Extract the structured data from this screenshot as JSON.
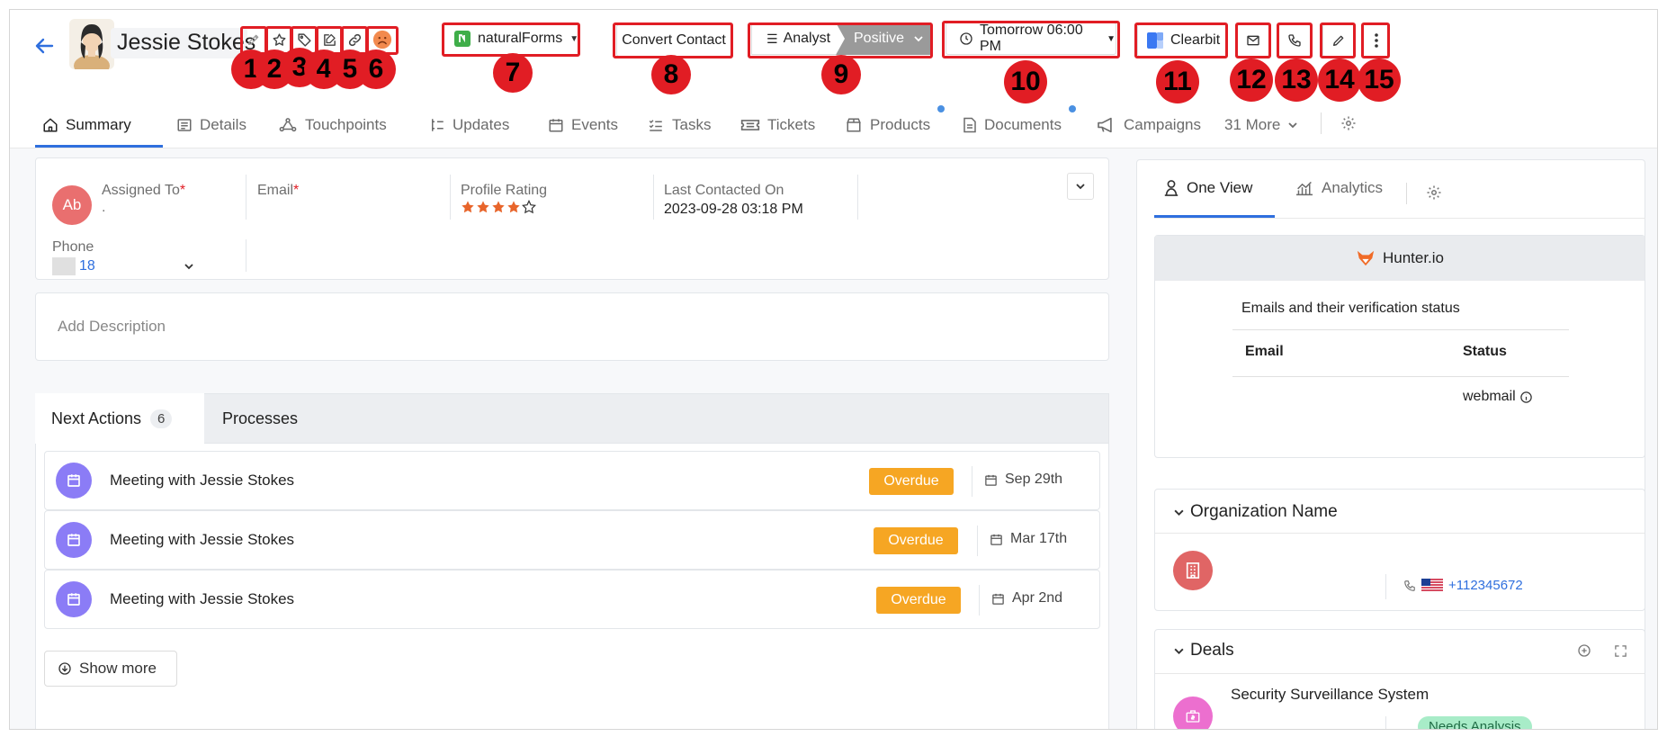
{
  "header": {
    "contact_name": "Jessie Stokes",
    "form_selector": "naturalForms",
    "convert_button": "Convert Contact",
    "pipeline_stage": "Analyst",
    "pipeline_status": "Positive",
    "reminder": "Tomorrow 06:00 PM",
    "integration_button": "Clearbit"
  },
  "annotations": [
    "1",
    "2",
    "3",
    "4",
    "5",
    "6",
    "7",
    "8",
    "9",
    "10",
    "11",
    "12",
    "13",
    "14",
    "15"
  ],
  "tabs": [
    {
      "label": "Summary",
      "icon": "home-icon"
    },
    {
      "label": "Details",
      "icon": "list-icon"
    },
    {
      "label": "Touchpoints",
      "icon": "touchpoints-icon"
    },
    {
      "label": "Updates",
      "icon": "updates-icon"
    },
    {
      "label": "Events",
      "icon": "calendar-icon"
    },
    {
      "label": "Tasks",
      "icon": "tasks-icon"
    },
    {
      "label": "Tickets",
      "icon": "ticket-icon"
    },
    {
      "label": "Products",
      "icon": "box-icon"
    },
    {
      "label": "Documents",
      "icon": "document-icon"
    },
    {
      "label": "Campaigns",
      "icon": "megaphone-icon"
    }
  ],
  "more_tabs": "31 More",
  "summary": {
    "assigned_to_label": "Assigned To",
    "assigned_initials": "Ab",
    "assigned_value": ".",
    "email_label": "Email",
    "required_mark": "*",
    "profile_rating_label": "Profile Rating",
    "profile_rating": 4,
    "profile_rating_max": 5,
    "last_contacted_label": "Last Contacted On",
    "last_contacted_value": "2023-09-28 03:18 PM",
    "phone_label": "Phone",
    "phone_value": "18"
  },
  "description_placeholder": "Add Description",
  "actions_tabs": {
    "next_actions": "Next Actions",
    "next_actions_count": "6",
    "processes": "Processes"
  },
  "actions": [
    {
      "title": "Meeting with Jessie Stokes",
      "status": "Overdue",
      "date": "Sep 29th"
    },
    {
      "title": "Meeting with Jessie Stokes",
      "status": "Overdue",
      "date": "Mar 17th"
    },
    {
      "title": "Meeting with Jessie Stokes",
      "status": "Overdue",
      "date": "Apr 2nd"
    }
  ],
  "show_more": "Show more",
  "right_panel": {
    "tab_one_view": "One View",
    "tab_analytics": "Analytics",
    "hunter_title": "Hunter.io",
    "hunter_subtitle": "Emails and their verification status",
    "col_email": "Email",
    "col_status": "Status",
    "status_value": "webmail",
    "org_section": "Organization Name",
    "org_phone": "+112345672",
    "deals_section": "Deals",
    "deal_title": "Security Surveillance System",
    "deal_stage": "Needs Analysis"
  },
  "colors": {
    "accent": "#2f6fde",
    "annotation": "#e11d24",
    "overdue": "#f6a623",
    "activity_icon": "#8b7cf6",
    "avatar_assigned": "#e96f6f",
    "org_avatar": "#e06565",
    "deal_avatar": "#ec6fcf",
    "rating_star": "#e8652b",
    "mood_icon": "#f28a4e",
    "natural_forms": "#3fae49",
    "clearbit": "#3a78f2",
    "hunter": "#f06b27",
    "needs_analysis": "#a8ecc8"
  }
}
